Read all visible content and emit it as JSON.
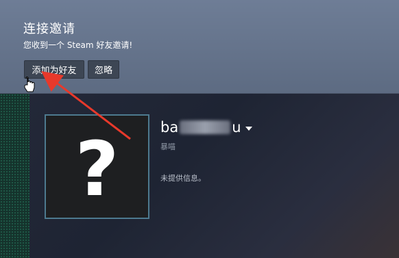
{
  "invite": {
    "title": "连接邀请",
    "message": "您收到一个 Steam 好友邀请!",
    "add_button": "添加为好友",
    "ignore_button": "忽略"
  },
  "profile": {
    "avatar_glyph": "?",
    "name_prefix": "ba",
    "name_suffix": "u",
    "subtitle": "暴喵",
    "info": "未提供信息。"
  },
  "colors": {
    "banner": "#6e7d96",
    "button": "#3d4654",
    "avatar_border": "#4d7a8f",
    "arrow": "#e8392b"
  }
}
